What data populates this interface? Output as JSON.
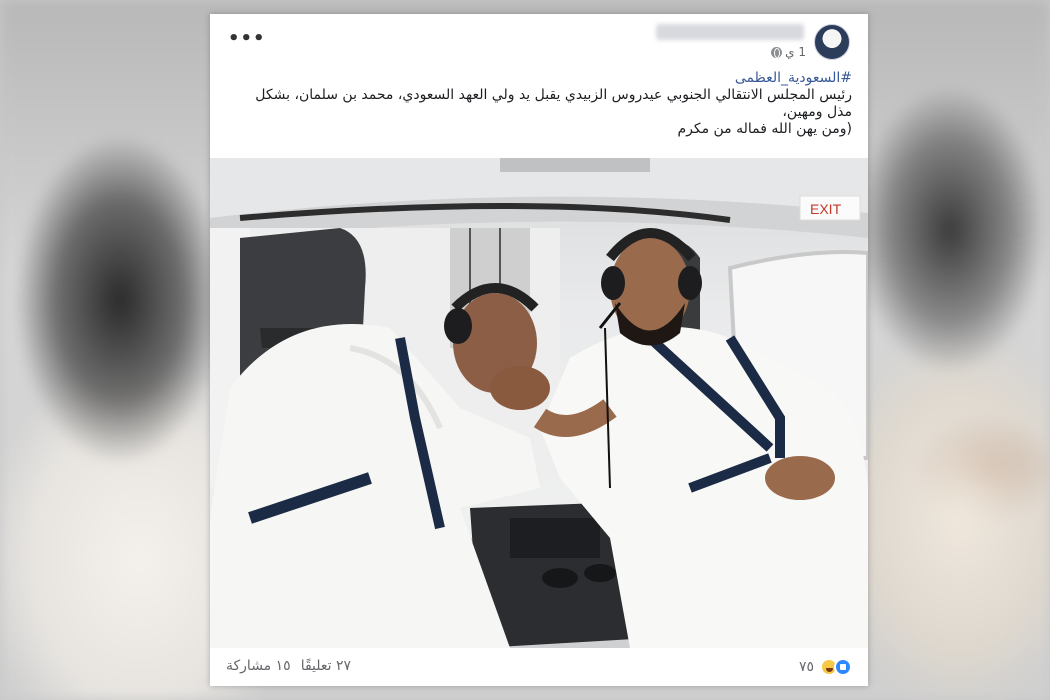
{
  "post": {
    "author_name": "",
    "time": "1 ي",
    "more_icon": "more-options-icon",
    "privacy_icon": "globe-icon",
    "hashtag": "#السعودية_العظمى",
    "body_line1": "رئيس المجلس الانتقالي الجنوبي عيدروس الزبيدي يقبل يد ولي العهد السعودي،  محمد بن سلمان، بشكل",
    "body_line2": "مذل ومهين،",
    "body_line3": "(ومن يهن الله فماله من مكرم",
    "photo_sign": "EXIT"
  },
  "footer": {
    "reaction_count": "٧٥",
    "comments": "٢٧ تعليقًا",
    "shares": "١٥ مشاركة"
  },
  "colors": {
    "link": "#385898",
    "like_blue": "#2d88ff",
    "text": "#1c1e21",
    "meta": "#65676b"
  }
}
